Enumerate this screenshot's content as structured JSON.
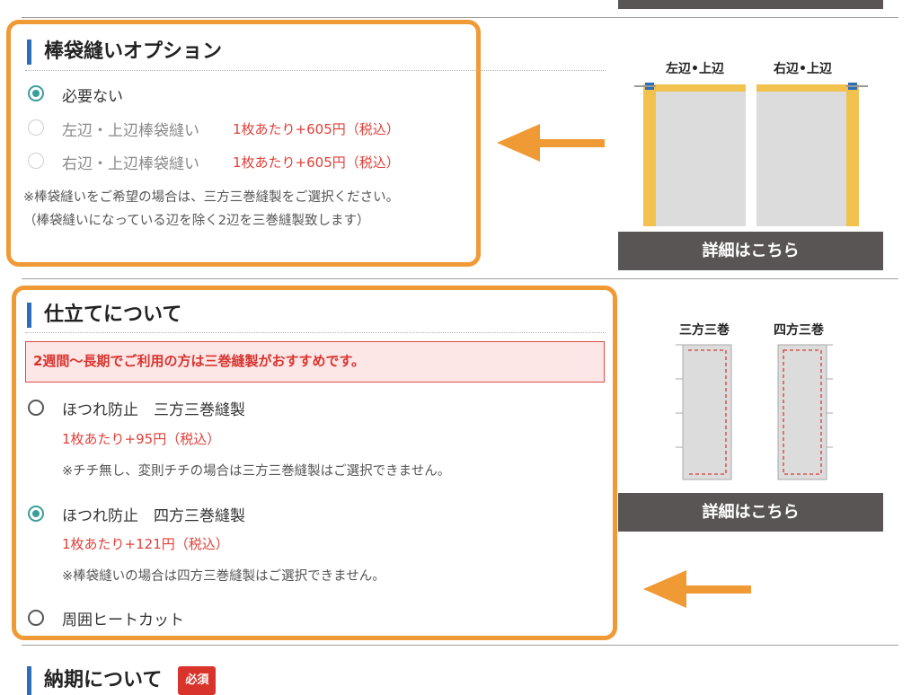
{
  "sewing_options": {
    "title": "棒袋縫いオプション",
    "options": [
      {
        "label": "必要ない",
        "price": "",
        "state": "selected"
      },
      {
        "label": "左辺・上辺棒袋縫い",
        "price": "1枚あたり+605円（税込）",
        "state": "disabled"
      },
      {
        "label": "右辺・上辺棒袋縫い",
        "price": "1枚あたり+605円（税込）",
        "state": "disabled"
      }
    ],
    "note_line1": "※棒袋縫いをご希望の場合は、三方三巻縫製をご選択ください。",
    "note_line2": "（棒袋縫いになっている辺を除く2辺を三巻縫製致します）",
    "figure_labels": [
      "左辺•上辺",
      "右辺•上辺"
    ],
    "detail_button": "詳細はこちら"
  },
  "finishing": {
    "title": "仕立てについて",
    "alert": "2週間〜長期でご利用の方は三巻縫製がおすすめです。",
    "options": [
      {
        "label": "ほつれ防止　三方三巻縫製",
        "price": "1枚あたり+95円（税込）",
        "note": "※チチ無し、変則チチの場合は三方三巻縫製はご選択できません。",
        "state": "unselected"
      },
      {
        "label": "ほつれ防止　四方三巻縫製",
        "price": "1枚あたり+121円（税込）",
        "note": "※棒袋縫いの場合は四方三巻縫製はご選択できません。",
        "state": "selected"
      },
      {
        "label": "周囲ヒートカット",
        "price": "",
        "note": "",
        "state": "unselected"
      }
    ],
    "figure_labels": [
      "三方三巻",
      "四方三巻"
    ],
    "detail_button": "詳細はこちら"
  },
  "delivery": {
    "title": "納期について",
    "badge": "必須"
  },
  "colors": {
    "highlight_orange": "#ef9a35",
    "accent_blue": "#2c6cb8",
    "radio_teal": "#3a9e9a",
    "price_red": "#e0403a",
    "button_gray": "#595555",
    "pole_yellow": "#f2c14e"
  },
  "icons": [
    "radio-selected-icon",
    "radio-icon",
    "arrow-left-icon"
  ]
}
